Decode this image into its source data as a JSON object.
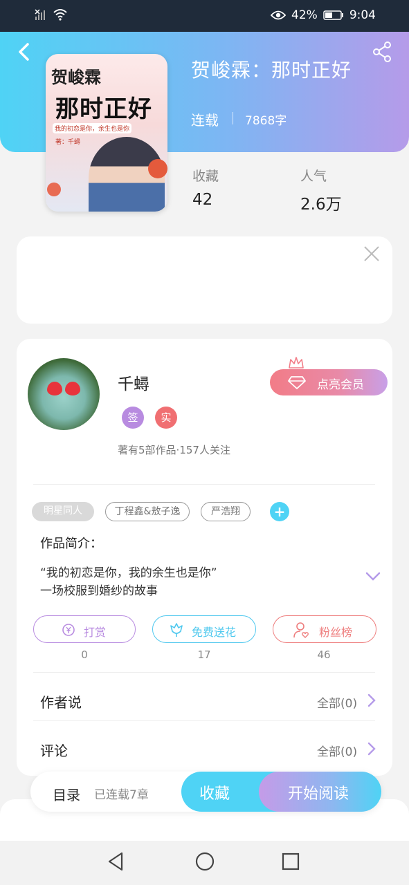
{
  "status": {
    "battery": "42%",
    "time": "9:04"
  },
  "book": {
    "title": "贺峻霖：那时正好",
    "status": "连载",
    "words": "7868字",
    "cover": {
      "line1": "贺峻霖",
      "line2": "那时正好",
      "tagline": "我的初恋是你，余生也是你",
      "author_line": "著：千蟳"
    }
  },
  "stats": {
    "favorites_label": "收藏",
    "favorites_value": "42",
    "popularity_label": "人气",
    "popularity_value": "2.6万"
  },
  "author": {
    "name": "千蟳",
    "badge_signed": "签",
    "badge_verified": "实",
    "meta": "著有5部作品·157人关注",
    "vip_label": "点亮会员"
  },
  "tags": [
    "明星同人",
    "丁程鑫&敖子逸",
    "严浩翔"
  ],
  "intro": {
    "title": "作品简介：",
    "lines": [
      "“我的初恋是你，我的余生也是你”",
      "一场校服到婚纱的故事"
    ]
  },
  "actions": [
    {
      "label": "打赏",
      "count": "0",
      "color": "#b88be0"
    },
    {
      "label": "免费送花",
      "count": "17",
      "color": "#4fc8ee"
    },
    {
      "label": "粉丝榜",
      "count": "46",
      "color": "#ee7d7d"
    }
  ],
  "rows": {
    "author_says": {
      "label": "作者说",
      "link": "全部(0)"
    },
    "comments": {
      "label": "评论",
      "link": "全部(0)"
    }
  },
  "bottom": {
    "toc": "目录",
    "chapters": "已连载7章",
    "collect": "收藏",
    "read": "开始阅读"
  },
  "colors": {
    "accent_cyan": "#4fd3f5",
    "accent_purple": "#b59be9",
    "vip_red": "#f27c87"
  }
}
